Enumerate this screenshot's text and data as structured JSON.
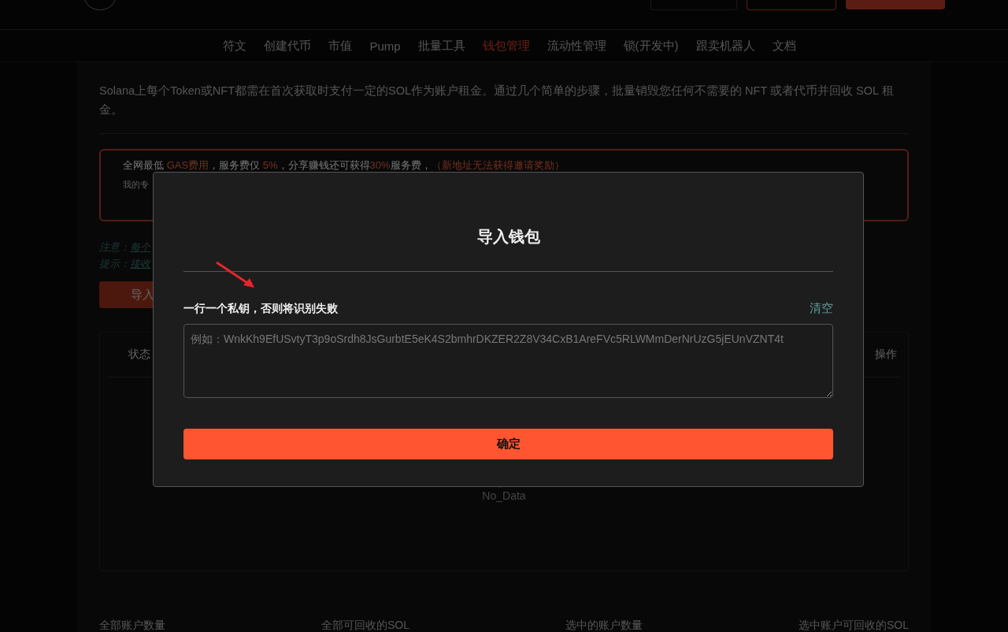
{
  "nav": [
    {
      "label": "符文",
      "selected": false
    },
    {
      "label": "创建代币",
      "selected": false
    },
    {
      "label": "市值",
      "selected": false
    },
    {
      "label": "Pump",
      "selected": false
    },
    {
      "label": "批量工具",
      "selected": false
    },
    {
      "label": "钱包管理",
      "selected": true
    },
    {
      "label": "流动性管理",
      "selected": false
    },
    {
      "label": "锁(开发中)",
      "selected": false
    },
    {
      "label": "跟卖机器人",
      "selected": false
    },
    {
      "label": "文档",
      "selected": false
    }
  ],
  "page": {
    "description": "Solana上每个Token或NFT都需在首次获取时支付一定的SOL作为账户租金。通过几个简单的步骤，批量销毁您任何不需要的 NFT 或者代币并回收 SOL 租金。",
    "promo": {
      "segments": [
        {
          "text": "全网最低 ",
          "highlight": false
        },
        {
          "text": "GAS费用",
          "highlight": true
        },
        {
          "text": "，服务费仅 ",
          "highlight": false
        },
        {
          "text": "5%",
          "highlight": true
        },
        {
          "text": "，分享赚钱还可获得",
          "highlight": false
        },
        {
          "text": "30%",
          "highlight": true
        },
        {
          "text": "服务费，",
          "highlight": false
        },
        {
          "text": "（新地址无法获得邀请奖励）",
          "highlight": true
        }
      ],
      "line_2": "我的专"
    },
    "notes": [
      {
        "label": "注意：",
        "text": "每个"
      },
      {
        "label": "提示：",
        "text": "接收"
      }
    ],
    "import_button": "导入",
    "table": {
      "columns": [
        "状态",
        "操作"
      ],
      "empty": "No_Data"
    },
    "stats": [
      "全部账户数量",
      "全部可回收的SOL",
      "选中的账户数量",
      "选中账户可回收的SOL"
    ]
  },
  "modal": {
    "title": "导入钱包",
    "label": "一行一个私钥，否则将识别失败",
    "clear": "清空",
    "placeholder": "例如：WnkKh9EfUSvtyT3p9oSrdh8JsGurbtE5eK4S2bmhrDKZER2Z8V34CxB1AreFVc5RLWMmDerNrUzG5jEUnVZNT4t",
    "confirm": "确定"
  }
}
